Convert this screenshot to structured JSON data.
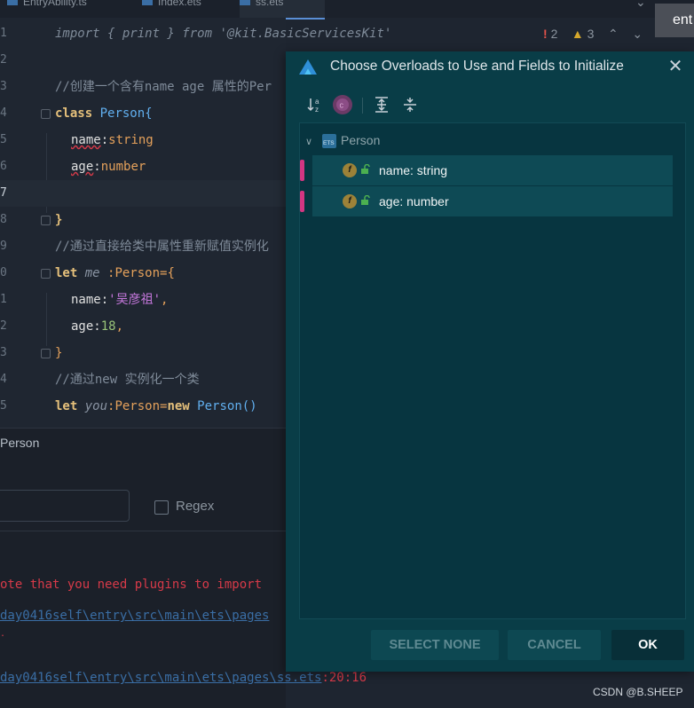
{
  "tabs": [
    {
      "label": "EntryAbility.ts"
    },
    {
      "label": "Index.ets"
    },
    {
      "label": "ss.ets"
    }
  ],
  "tooltip": {
    "text": "ent"
  },
  "status": {
    "errors": "2",
    "warnings": "3"
  },
  "editor": {
    "lines": [
      {
        "n": "1"
      },
      {
        "n": "2"
      },
      {
        "n": "3"
      },
      {
        "n": "4"
      },
      {
        "n": "5"
      },
      {
        "n": "6"
      },
      {
        "n": "7"
      },
      {
        "n": "8"
      },
      {
        "n": "9"
      },
      {
        "n": "0"
      },
      {
        "n": "1"
      },
      {
        "n": "2"
      },
      {
        "n": "3"
      },
      {
        "n": "4"
      },
      {
        "n": "5"
      }
    ],
    "l1": {
      "kw1": "import",
      "body": " { print } ",
      "kw2": "from",
      "str": " '@kit.BasicServicesKit'"
    },
    "l3": {
      "comment": "//创建一个含有name age 属性的Per"
    },
    "l4": {
      "kw": "class",
      "name": " Person{"
    },
    "l5": {
      "prop": "name",
      "colon": ":",
      "type": "string"
    },
    "l6": {
      "prop": "age",
      "colon": ":",
      "type": "number"
    },
    "l8": {
      "text": "}"
    },
    "l9": {
      "comment": "//通过直接给类中属性重新赋值实例化"
    },
    "l10": {
      "kw": "let",
      "var": " me",
      "rest": " :Person={"
    },
    "l11": {
      "prop": "name",
      "colon": ":",
      "str": "'吴彦祖'",
      "tail": ","
    },
    "l12": {
      "prop": "age",
      "colon": ":",
      "num": "18",
      "tail": ","
    },
    "l13": {
      "text": "}"
    },
    "l14": {
      "comment": "//通过new 实例化一个类"
    },
    "l15": {
      "kw": "let",
      "var": " you",
      "mid": ":Person=",
      "kw2": "new",
      "cls": " Person()"
    }
  },
  "panel": {
    "title": "Person",
    "regex_label": "Regex",
    "out1": "ote that you need plugins to import",
    "out2": "day0416self\\entry\\src\\main\\ets\\pages",
    "out3": "day0416self\\entry\\src\\main\\ets\\pages\\ss.ets",
    "out3_suffix": ":20:16"
  },
  "dialog": {
    "title": "Choose Overloads to Use and Fields to Initialize",
    "root_label": "Person",
    "fields": [
      {
        "label": "name: string"
      },
      {
        "label": "age: number"
      }
    ],
    "buttons": {
      "select_none": "SELECT NONE",
      "cancel": "CANCEL",
      "ok": "OK"
    }
  },
  "watermark": "CSDN @B.SHEEP"
}
